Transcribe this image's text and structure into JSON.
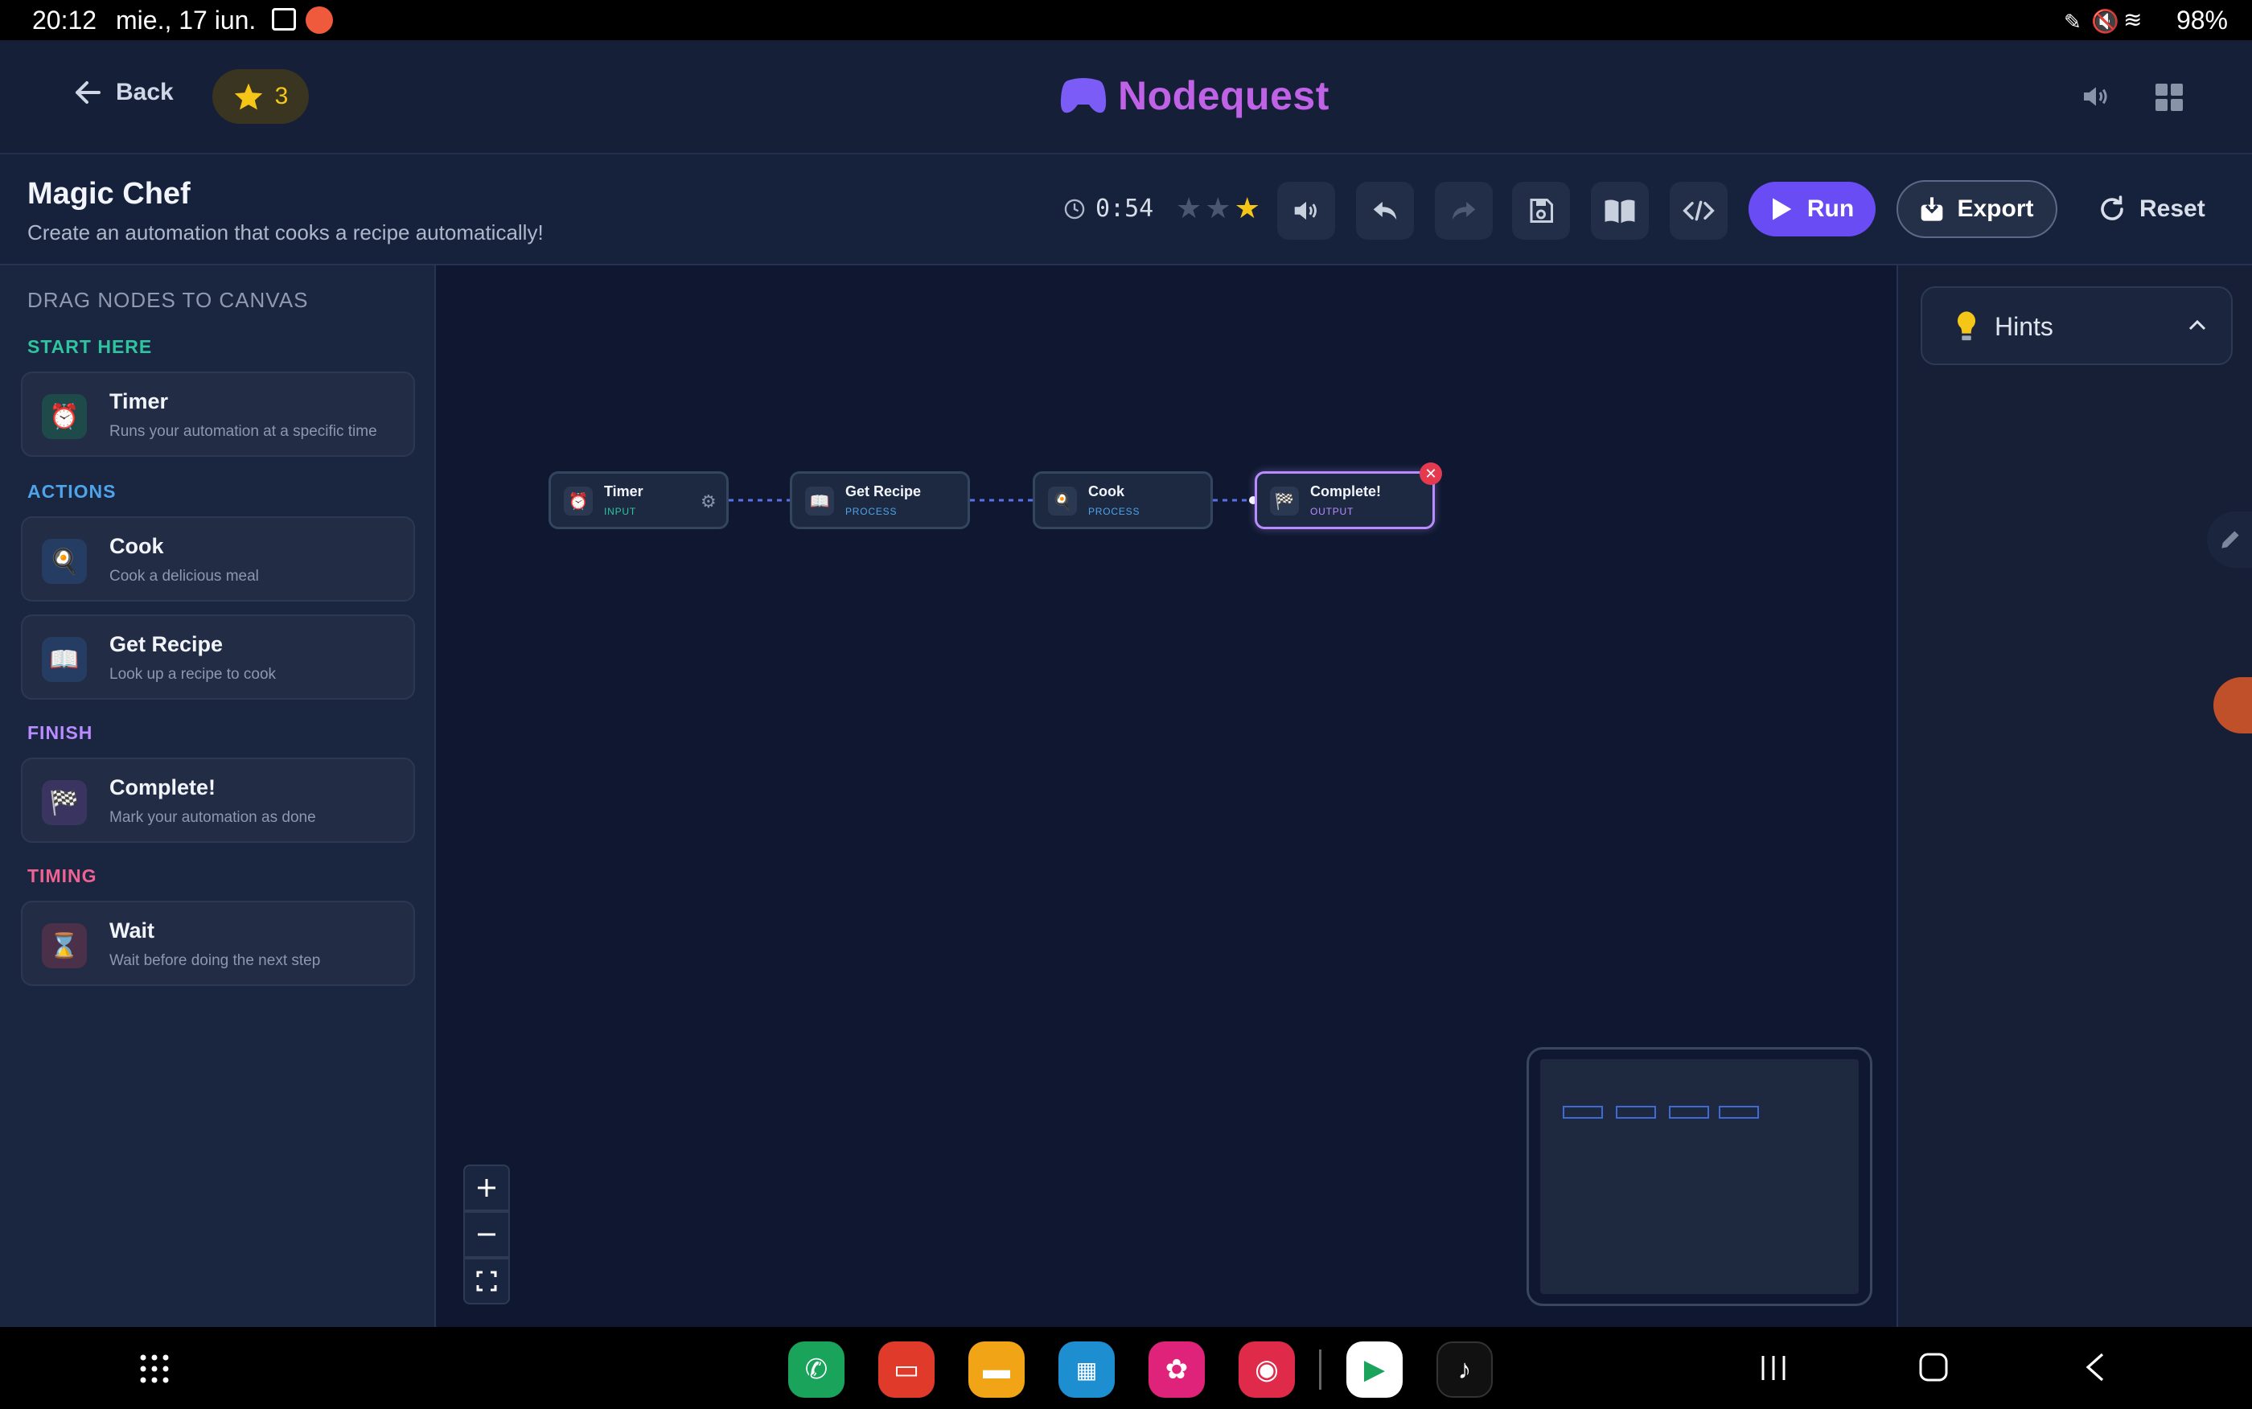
{
  "status_bar": {
    "time": "20:12",
    "date": "mie., 17 iun.",
    "battery": "98%"
  },
  "header": {
    "back_label": "Back",
    "star_count": "3",
    "brand": "Nodequest"
  },
  "level": {
    "title": "Magic Chef",
    "subtitle": "Create an automation that cooks a recipe automatically!",
    "timer": "0:54",
    "stars_earned": 1,
    "stars_total": 3,
    "run_label": "Run",
    "export_label": "Export",
    "reset_label": "Reset"
  },
  "sidebar": {
    "title": "DRAG NODES TO CANVAS",
    "sections": [
      {
        "label": "START HERE",
        "color": "#2ec4a0"
      },
      {
        "label": "ACTIONS",
        "color": "#4fa3e8"
      },
      {
        "label": "FINISH",
        "color": "#b98cff"
      },
      {
        "label": "TIMING",
        "color": "#f06292"
      }
    ],
    "items": [
      {
        "name": "Timer",
        "desc": "Runs your automation at a specific time",
        "icon": "alarm-clock-icon"
      },
      {
        "name": "Cook",
        "desc": "Cook a delicious meal",
        "icon": "frying-egg-icon"
      },
      {
        "name": "Get Recipe",
        "desc": "Look up a recipe to cook",
        "icon": "open-book-icon"
      },
      {
        "name": "Complete!",
        "desc": "Mark your automation as done",
        "icon": "checkered-flag-icon"
      },
      {
        "name": "Wait",
        "desc": "Wait before doing the next step",
        "icon": "hourglass-icon"
      }
    ]
  },
  "canvas": {
    "nodes": [
      {
        "label": "Timer",
        "type": "INPUT",
        "icon": "alarm-clock-icon"
      },
      {
        "label": "Get Recipe",
        "type": "PROCESS",
        "icon": "open-book-icon"
      },
      {
        "label": "Cook",
        "type": "PROCESS",
        "icon": "frying-egg-icon"
      },
      {
        "label": "Complete!",
        "type": "OUTPUT",
        "icon": "checkered-flag-icon"
      }
    ]
  },
  "hints": {
    "label": "Hints"
  },
  "colors": {
    "accent": "#6a4cf5",
    "brand": "#c062e6",
    "star": "#f5c518",
    "input_tag": "#2ec4a0",
    "process_tag": "#4fa3e8",
    "output_tag": "#b98cff"
  }
}
